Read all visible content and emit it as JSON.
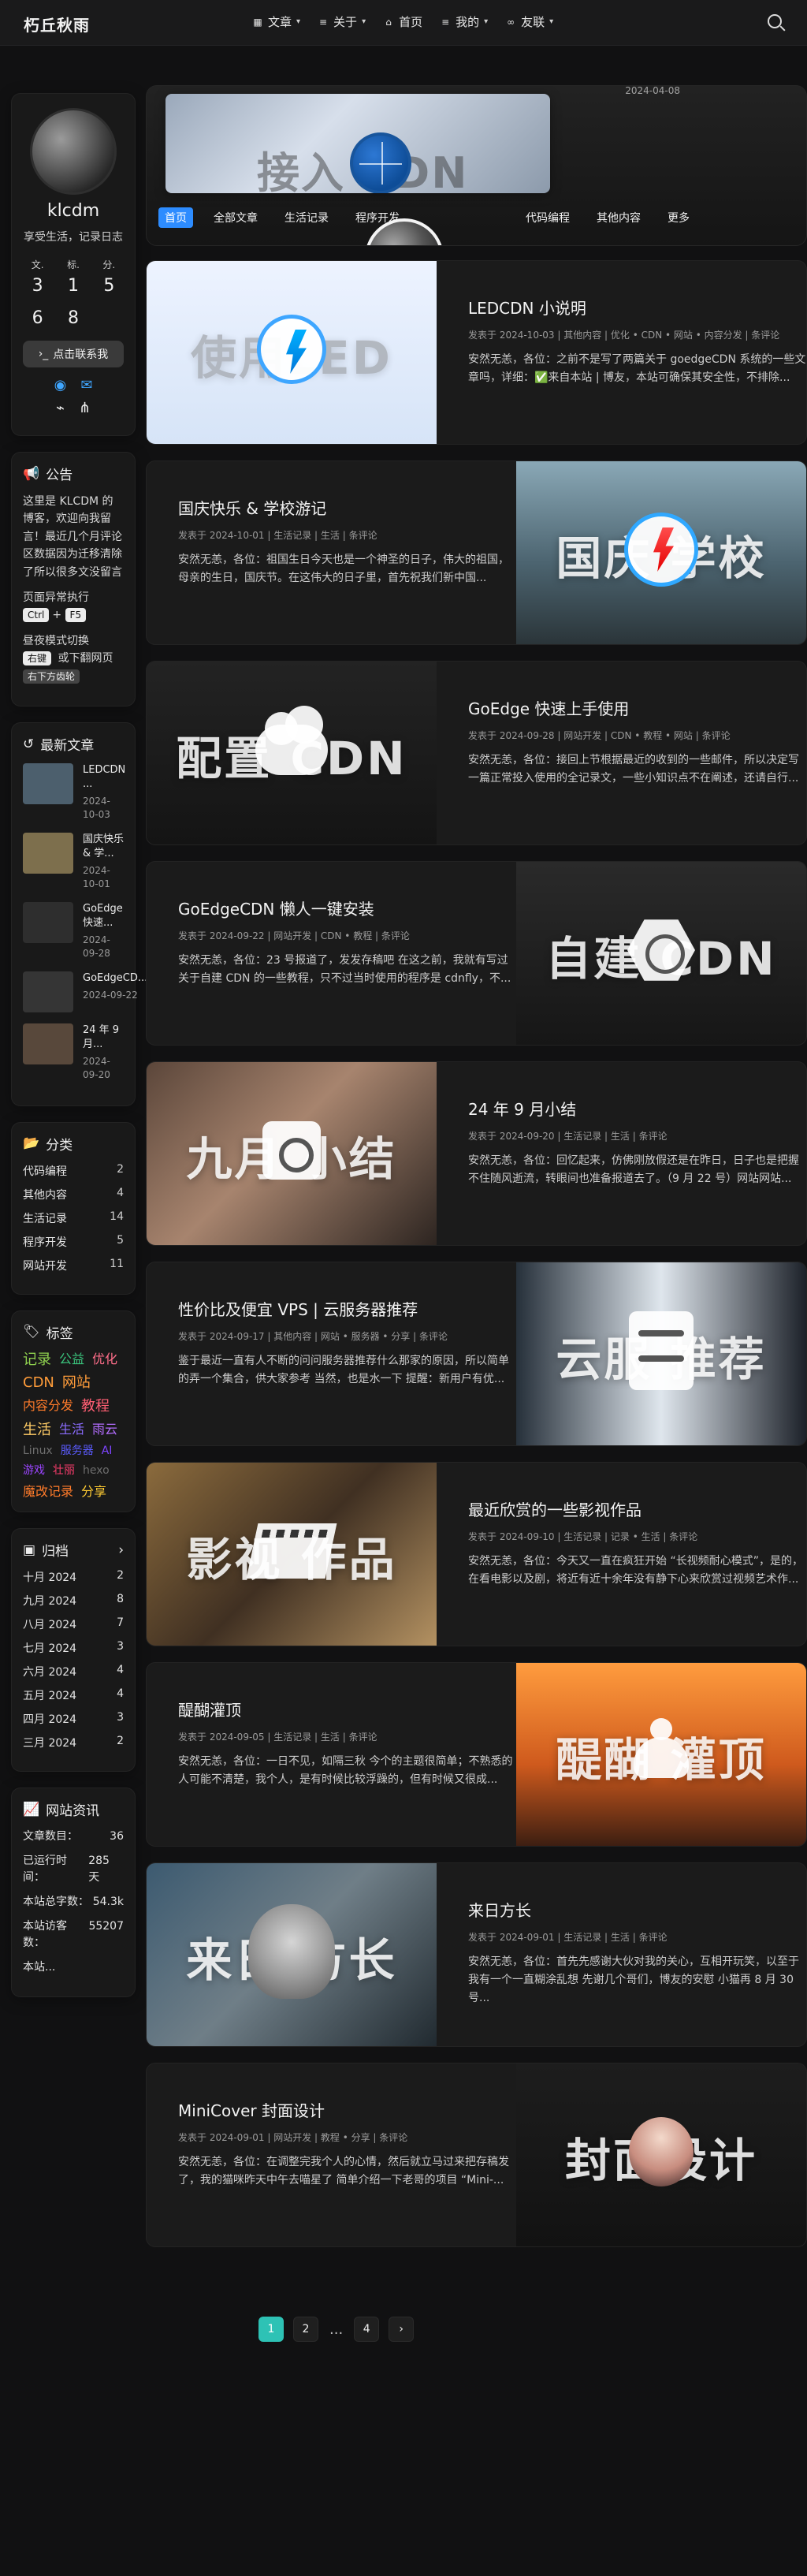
{
  "header": {
    "brand": "朽丘秋雨",
    "nav": [
      {
        "label": "文章",
        "icon": "book-icon"
      },
      {
        "label": "关于",
        "icon": "list-icon"
      },
      {
        "label": "首页",
        "icon": "home-icon"
      },
      {
        "label": "我的",
        "icon": "list-icon"
      },
      {
        "label": "友联",
        "icon": "link-icon"
      }
    ]
  },
  "profile": {
    "name": "klcdm",
    "description": "享受生活，记录日志",
    "stats": [
      {
        "label": "文.",
        "value": "3"
      },
      {
        "label": "标.",
        "value": "1"
      },
      {
        "label": "分.",
        "value": "5"
      },
      {
        "label": "",
        "value": "6"
      },
      {
        "label": "",
        "value": "8"
      },
      {
        "label": "",
        "value": ""
      }
    ],
    "bookmark_label": "点击联系我",
    "social_icons": [
      "github-icon",
      "mail-icon",
      "rss-icon",
      "sitemap-icon"
    ]
  },
  "notice": {
    "title": "公告",
    "text": "这里是 KLCDM 的博客，欢迎向我留言！最近几个月评论区数据因为迁移清除了所以很多文没留言",
    "shortcut_1_text": "页面异常执行",
    "shortcut_1_keys": [
      "Ctrl",
      "F5"
    ],
    "shortcut_2_text": "昼夜模式切换",
    "shortcut_2_keys": [
      "右键",
      "或下翻网页",
      "右下方齿轮"
    ]
  },
  "recent": {
    "title": "最新文章",
    "items": [
      {
        "title": "LEDCDN ...",
        "date": "2024-10-03",
        "color": "#4c5f6d"
      },
      {
        "title": "国庆快乐 & 学...",
        "date": "2024-10-01",
        "color": "#7d6f4d"
      },
      {
        "title": "GoEdge 快速...",
        "date": "2024-09-28",
        "color": "#2e2e2e"
      },
      {
        "title": "GoEdgeCD...",
        "date": "2024-09-22",
        "color": "#353535"
      },
      {
        "title": "24 年 9 月...",
        "date": "2024-09-20",
        "color": "#58483b"
      }
    ]
  },
  "categories": {
    "title": "分类",
    "items": [
      {
        "name": "代码编程",
        "count": "2"
      },
      {
        "name": "其他内容",
        "count": "4"
      },
      {
        "name": "生活记录",
        "count": "14"
      },
      {
        "name": "程序开发",
        "count": "5"
      },
      {
        "name": "网站开发",
        "count": "11"
      }
    ]
  },
  "tags": {
    "title": "标签",
    "items": [
      {
        "name": "记录",
        "color": "#8fd14f",
        "size": 18
      },
      {
        "name": "公益",
        "color": "#3ac37c",
        "size": 16
      },
      {
        "name": "优化",
        "color": "#ff6e8a",
        "size": 16
      },
      {
        "name": "CDN",
        "color": "#ff9c3a",
        "size": 18
      },
      {
        "name": "网站",
        "color": "#ff9c3a",
        "size": 18
      },
      {
        "name": "内容分发",
        "color": "#ff7b2a",
        "size": 16
      },
      {
        "name": "教程",
        "color": "#ff5e73",
        "size": 18
      },
      {
        "name": "生活",
        "color": "#ffcc66",
        "size": 18
      },
      {
        "name": "生活",
        "color": "#8b6cff",
        "size": 16
      },
      {
        "name": "雨云",
        "color": "#b36dff",
        "size": 16
      },
      {
        "name": "Linux",
        "color": "#6f6f6f",
        "size": 14
      },
      {
        "name": "服务器",
        "color": "#5b5bff",
        "size": 14
      },
      {
        "name": "AI",
        "color": "#7e44ff",
        "size": 14
      },
      {
        "name": "游戏",
        "color": "#9b44ff",
        "size": 14
      },
      {
        "name": "壮丽",
        "color": "#ff3d6e",
        "size": 14
      },
      {
        "name": "hexo",
        "color": "#6c6c6c",
        "size": 14
      },
      {
        "name": "魔改记录",
        "color": "#ff7b2a",
        "size": 16
      },
      {
        "name": "分享",
        "color": "#ffcc33",
        "size": 16
      }
    ]
  },
  "archive": {
    "title": "归档",
    "items": [
      {
        "month": "十月 2024",
        "count": "2"
      },
      {
        "month": "九月 2024",
        "count": "8"
      },
      {
        "month": "八月 2024",
        "count": "7"
      },
      {
        "month": "七月 2024",
        "count": "3"
      },
      {
        "month": "六月 2024",
        "count": "4"
      },
      {
        "month": "五月 2024",
        "count": "4"
      },
      {
        "month": "四月 2024",
        "count": "3"
      },
      {
        "month": "三月 2024",
        "count": "2"
      }
    ]
  },
  "site_info": {
    "title": "网站资讯",
    "items": [
      {
        "label": "文章数目：",
        "value": "36"
      },
      {
        "label": "已运行时间：",
        "value": "285 天"
      },
      {
        "label": "本站总字数：",
        "value": "54.3k"
      },
      {
        "label": "本站访客数：",
        "value": "55207"
      },
      {
        "label": "本站...",
        "value": ""
      }
    ]
  },
  "hero": {
    "title": "接入 CDN",
    "date": "2024-04-08",
    "tabs": [
      "首页",
      "全部文章",
      "生活记录",
      "程序开发",
      "代码编程",
      "其他内容",
      "更多"
    ]
  },
  "posts": [
    {
      "layout": "left",
      "title": "LEDCDN 小说明",
      "meta": "发表于 2024-10-03 | 其他内容 | 优化 • CDN • 网站 • 内容分发 | 条评论",
      "excerpt": "安然无恙，各位：之前不是写了两篇关于 goedgeCDN 系统的一些文章吗，详细：✅来自本站 | 博友，本站可确保其安全性，不排除...",
      "cover_text": "使用LED",
      "theme": "led"
    },
    {
      "layout": "right",
      "title": "国庆快乐 & 学校游记",
      "meta": "发表于 2024-10-01 | 生活记录 | 生活 | 条评论",
      "excerpt": "安然无恙，各位：祖国生日今天也是一个神圣的日子，伟大的祖国，母亲的生日，国庆节。在这伟大的日子里，首先祝我们新中国...",
      "cover_text": "国庆 学校",
      "theme": "national"
    },
    {
      "layout": "left",
      "title": "GoEdge 快速上手使用",
      "meta": "发表于 2024-09-28 | 网站开发 | CDN • 教程 • 网站 | 条评论",
      "excerpt": "安然无恙，各位：接回上节根据最近的收到的一些邮件，所以决定写一篇正常投入使用的全记录文，一些小知识点不在阐述，还请自行...",
      "cover_text": "配置 CDN",
      "theme": "config"
    },
    {
      "layout": "right",
      "title": "GoEdgeCDN 懒人一键安装",
      "meta": "发表于 2024-09-22 | 网站开发 | CDN • 教程 | 条评论",
      "excerpt": "安然无恙，各位：23 号报道了，发发存稿吧 在这之前，我就有写过关于自建 CDN 的一些教程，只不过当时使用的程序是 cdnfly，不...",
      "cover_text": "自建 CDN",
      "theme": "selfcdn"
    },
    {
      "layout": "left",
      "title": "24 年 9 月小结",
      "meta": "发表于 2024-09-20 | 生活记录 | 生活 | 条评论",
      "excerpt": "安然无恙，各位：回忆起来，仿佛刚放假还是在昨日，日子也是把握不住随风逝流，转眼间也准备报道去了。（9 月 22 号）网站网站...",
      "cover_text": "九月 小结",
      "theme": "sept"
    },
    {
      "layout": "right",
      "title": "性价比及便宜 VPS | 云服务器推荐",
      "meta": "发表于 2024-09-17 | 其他内容 | 网站 • 服务器 • 分享 | 条评论",
      "excerpt": "鉴于最近一直有人不断的问问服务器推荐什么那家的原因，所以简单的弄一个集合，供大家参考 当然，也是水一下 提醒：新用户有优...",
      "cover_text": "云服 推荐",
      "theme": "server"
    },
    {
      "layout": "left",
      "title": "最近欣赏的一些影视作品",
      "meta": "发表于 2024-09-10 | 生活记录 | 记录 • 生活 | 条评论",
      "excerpt": "安然无恙，各位：今天又一直在疯狂开始 “长视频耐心模式”，是的，在看电影以及剧，将近有近十余年没有静下心来欣赏过视频艺术作...",
      "cover_text": "影视 作品",
      "theme": "film"
    },
    {
      "layout": "right",
      "title": "醍醐灌顶",
      "meta": "发表于 2024-09-05 | 生活记录 | 生活 | 条评论",
      "excerpt": "安然无恙，各位：一日不见，如隔三秋 今个的主题很简单；不熟悉的人可能不清楚，我个人，是有时候比较浮躁的，但有时候又很成...",
      "cover_text": "醍醐 灌顶",
      "theme": "sunset"
    },
    {
      "layout": "left",
      "title": "来日方长",
      "meta": "发表于 2024-09-01 | 生活记录 | 生活 | 条评论",
      "excerpt": "安然无恙，各位：首先先感谢大伙对我的关心，互相开玩笑，以至于我有一个一直糊涂乱想 先谢几个哥们，博友的安慰 小猫再 8 月 30 号...",
      "cover_text": "来日 方长",
      "theme": "cat"
    },
    {
      "layout": "right",
      "title": "MiniCover 封面设计",
      "meta": "发表于 2024-09-01 | 网站开发 | 教程 • 分享 | 条评论",
      "excerpt": "安然无恙，各位：在调整完我个人的心情，然后就立马过来把存稿发了，我的猫咪昨天中午去喵星了 简单介绍一下老哥的项目 “Mini-...",
      "cover_text": "封面设计",
      "theme": "anime"
    }
  ],
  "pagination": {
    "pages": [
      "1",
      "2",
      "...",
      "4"
    ],
    "next_icon": "chevron-right-icon"
  }
}
